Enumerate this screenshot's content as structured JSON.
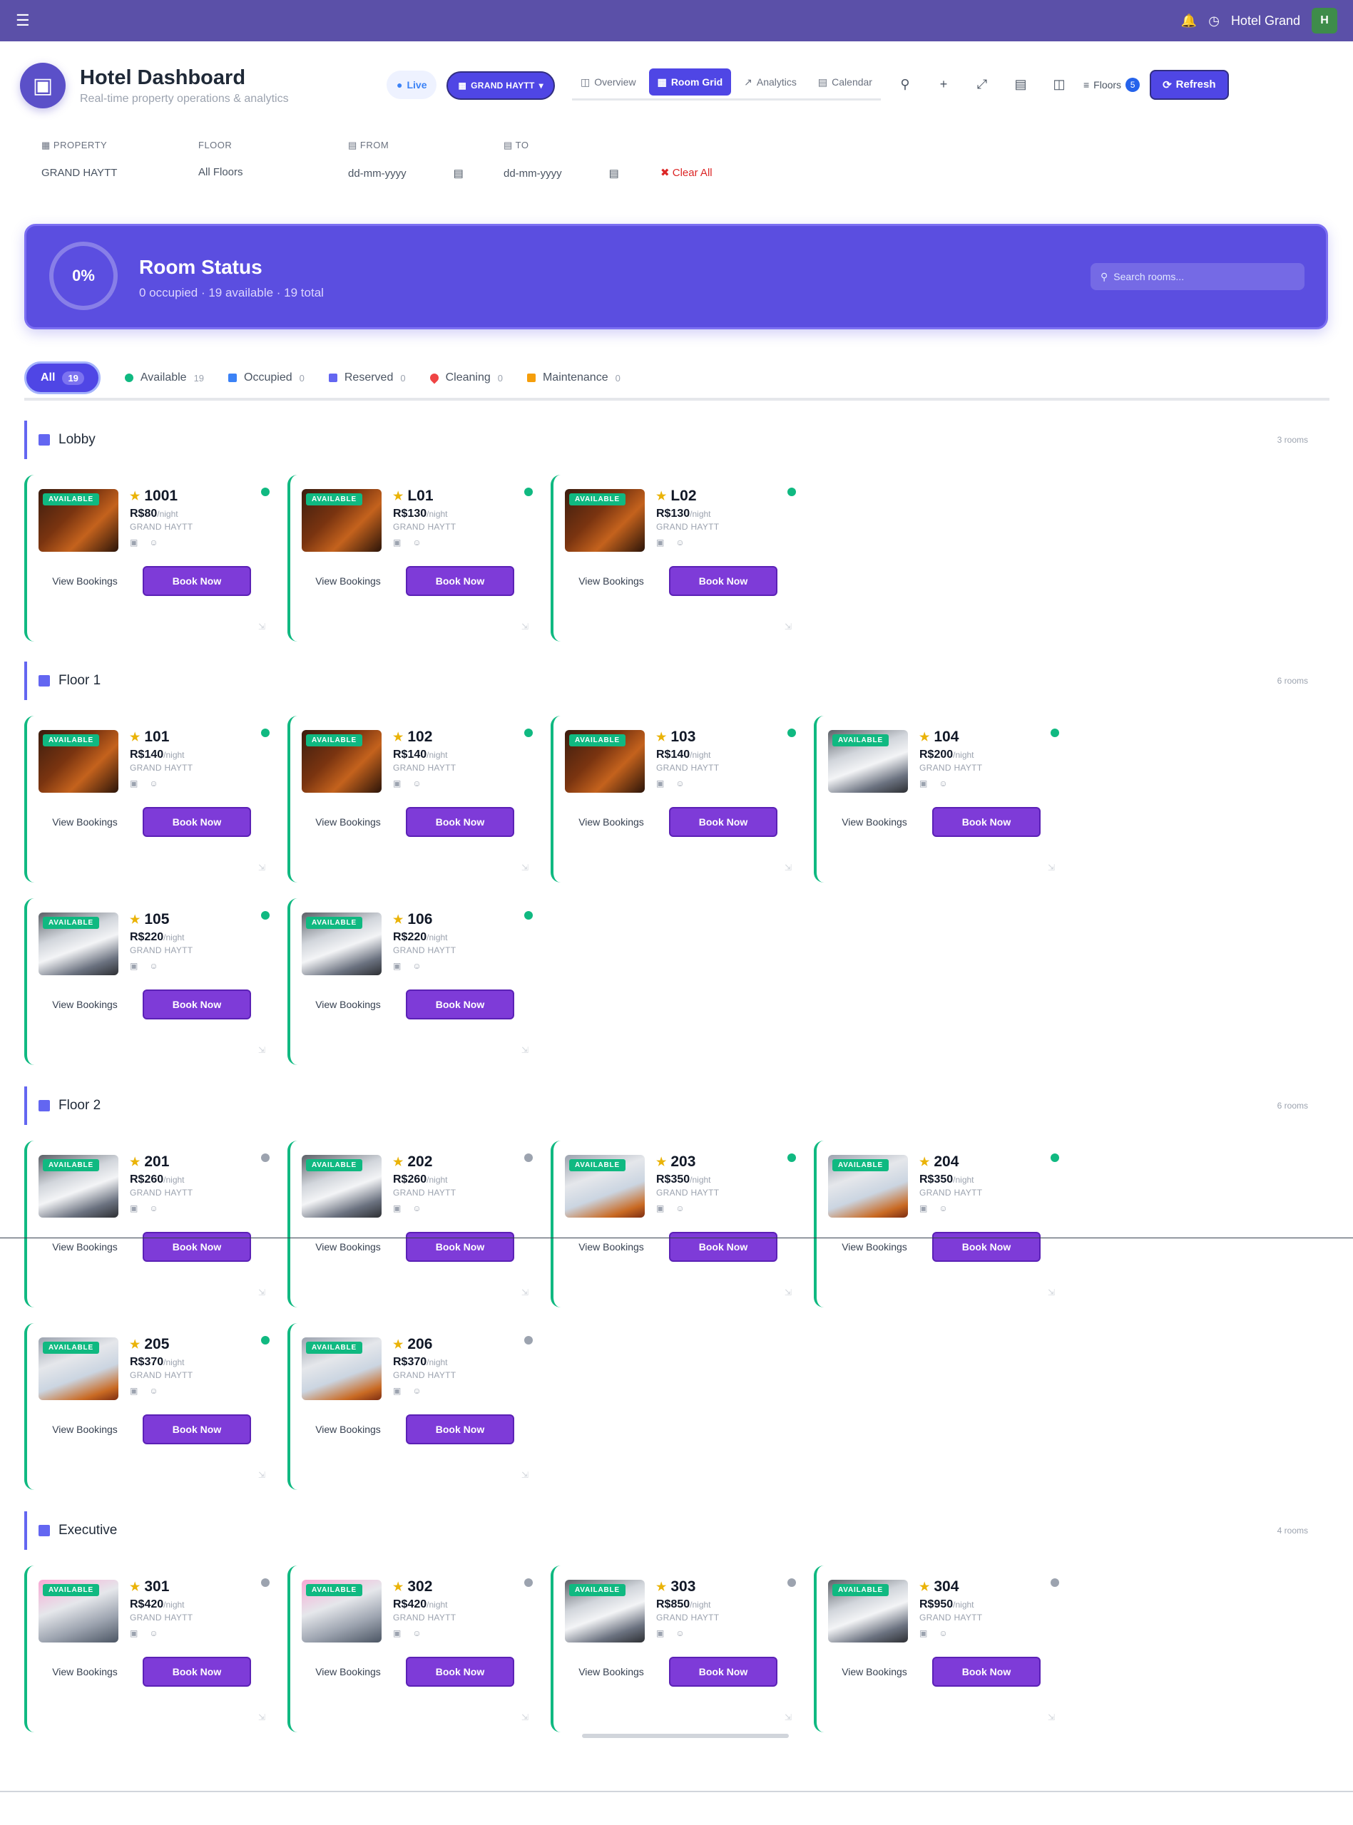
{
  "topbar": {
    "user_name": "Hotel Grand"
  },
  "header": {
    "title": "Hotel Dashboard",
    "subtitle": "Real-time property operations & analytics"
  },
  "controls": {
    "live_label": "Live",
    "property_label": "GRAND HAYTT",
    "tabs": [
      "Overview",
      "Room Grid",
      "Analytics",
      "Calendar"
    ],
    "active_tab": "Room Grid",
    "floors_label": "Floors",
    "floors_count": "5",
    "refresh_label": "Refresh"
  },
  "filters": {
    "property_label": "PROPERTY",
    "property_value": "GRAND HAYTT",
    "floor_label": "FLOOR",
    "floor_value": "All Floors",
    "from_label": "FROM",
    "from_placeholder": "dd-mm-yyyy",
    "to_label": "TO",
    "to_placeholder": "dd-mm-yyyy",
    "clear_label": "Clear All"
  },
  "status": {
    "percent": "0%",
    "title": "Room Status",
    "summary": "0 occupied · 19 available · 19 total",
    "search_placeholder": "Search rooms..."
  },
  "chips": [
    {
      "label": "All",
      "count": "19",
      "color": "all"
    },
    {
      "label": "Available",
      "count": "19",
      "color": "green"
    },
    {
      "label": "Occupied",
      "count": "0",
      "color": "blue"
    },
    {
      "label": "Reserved",
      "count": "0",
      "color": "purple"
    },
    {
      "label": "Cleaning",
      "count": "0",
      "color": "red"
    },
    {
      "label": "Maintenance",
      "count": "0",
      "color": "amber"
    }
  ],
  "labels": {
    "view_bookings": "View Bookings",
    "book_now": "Book Now",
    "available": "AVAILABLE",
    "per_night": "/night"
  },
  "sections": [
    {
      "name": "Lobby",
      "count": "3 rooms",
      "rooms": [
        {
          "number": "1001",
          "price": "R$80",
          "property": "GRAND HAYTT",
          "img": "warm"
        },
        {
          "number": "L01",
          "price": "R$130",
          "property": "GRAND HAYTT",
          "img": "warm"
        },
        {
          "number": "L02",
          "price": "R$130",
          "property": "GRAND HAYTT",
          "img": "warm"
        }
      ]
    },
    {
      "name": "Floor 1",
      "count": "6 rooms",
      "rooms": [
        {
          "number": "101",
          "price": "R$140",
          "property": "GRAND HAYTT",
          "img": "warm"
        },
        {
          "number": "102",
          "price": "R$140",
          "property": "GRAND HAYTT",
          "img": "warm"
        },
        {
          "number": "103",
          "price": "R$140",
          "property": "GRAND HAYTT",
          "img": "warm"
        },
        {
          "number": "104",
          "price": "R$200",
          "property": "GRAND HAYTT",
          "img": "bed"
        },
        {
          "number": "105",
          "price": "R$220",
          "property": "GRAND HAYTT",
          "img": "bed"
        },
        {
          "number": "106",
          "price": "R$220",
          "property": "GRAND HAYTT",
          "img": "bed"
        }
      ]
    },
    {
      "name": "Floor 2",
      "count": "6 rooms",
      "rooms": [
        {
          "number": "201",
          "price": "R$260",
          "property": "GRAND HAYTT",
          "img": "bed",
          "dot": "grey"
        },
        {
          "number": "202",
          "price": "R$260",
          "property": "GRAND HAYTT",
          "img": "bed",
          "dot": "grey"
        },
        {
          "number": "203",
          "price": "R$350",
          "property": "GRAND HAYTT",
          "img": "grey"
        },
        {
          "number": "204",
          "price": "R$350",
          "property": "GRAND HAYTT",
          "img": "grey"
        },
        {
          "number": "205",
          "price": "R$370",
          "property": "GRAND HAYTT",
          "img": "grey"
        },
        {
          "number": "206",
          "price": "R$370",
          "property": "GRAND HAYTT",
          "img": "grey",
          "dot": "grey"
        }
      ]
    },
    {
      "name": "Executive",
      "count": "4 rooms",
      "rooms": [
        {
          "number": "301",
          "price": "R$420",
          "property": "GRAND HAYTT",
          "img": "exec",
          "dot": "grey"
        },
        {
          "number": "302",
          "price": "R$420",
          "property": "GRAND HAYTT",
          "img": "exec",
          "dot": "grey"
        },
        {
          "number": "303",
          "price": "R$850",
          "property": "GRAND HAYTT",
          "img": "bed",
          "dot": "grey"
        },
        {
          "number": "304",
          "price": "R$950",
          "property": "GRAND HAYTT",
          "img": "bed",
          "dot": "grey"
        }
      ]
    }
  ]
}
